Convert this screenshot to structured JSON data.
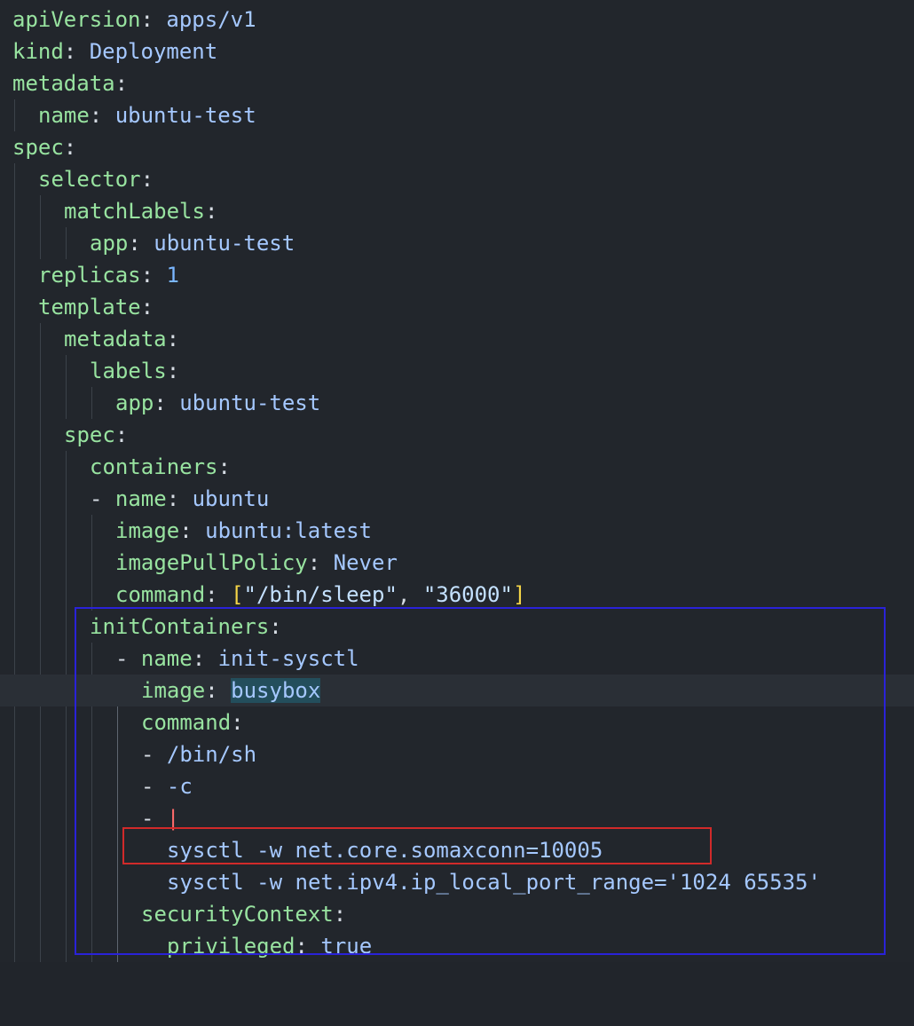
{
  "editor": {
    "language": "yaml",
    "colors": {
      "background": "#22262c",
      "key": "#98e3a0",
      "value": "#a5c8ff",
      "current_line": "#2a2f36",
      "blue_annotation": "#2a22d8",
      "red_annotation": "#d12a2a",
      "search_highlight": "#234e5c"
    },
    "lines": [
      {
        "key": "apiVersion",
        "value": "apps/v1"
      },
      {
        "key": "kind",
        "value": "Deployment"
      },
      {
        "key": "metadata"
      },
      {
        "key": "name",
        "value": "ubuntu-test"
      },
      {
        "key": "spec"
      },
      {
        "key": "selector"
      },
      {
        "key": "matchLabels"
      },
      {
        "key": "app",
        "value": "ubuntu-test"
      },
      {
        "key": "replicas",
        "value": "1"
      },
      {
        "key": "template"
      },
      {
        "key": "metadata"
      },
      {
        "key": "labels"
      },
      {
        "key": "app",
        "value": "ubuntu-test"
      },
      {
        "key": "spec"
      },
      {
        "key": "containers"
      },
      {
        "dash": "-",
        "key": "name",
        "value": "ubuntu"
      },
      {
        "key": "image",
        "value": "ubuntu:latest"
      },
      {
        "key": "imagePullPolicy",
        "value": "Never"
      },
      {
        "key": "command",
        "list_open": "[",
        "items": [
          "\"/bin/sleep\"",
          "\"36000\""
        ],
        "sep": ", ",
        "list_close": "]"
      },
      {
        "key": "initContainers"
      },
      {
        "dash": "-",
        "key": "name",
        "value": "init-sysctl"
      },
      {
        "key": "image",
        "value": "busybox"
      },
      {
        "key": "command"
      },
      {
        "dash": "-",
        "value": "/bin/sh"
      },
      {
        "dash": "-",
        "value": "-c"
      },
      {
        "dash": "-",
        "value": "|"
      },
      {
        "value": "sysctl -w net.core.somaxconn=10005"
      },
      {
        "value": "sysctl -w net.ipv4.ip_local_port_range='1024 65535'"
      },
      {
        "key": "securityContext"
      },
      {
        "key": "privileged",
        "value": "true"
      }
    ],
    "colon": ":"
  }
}
